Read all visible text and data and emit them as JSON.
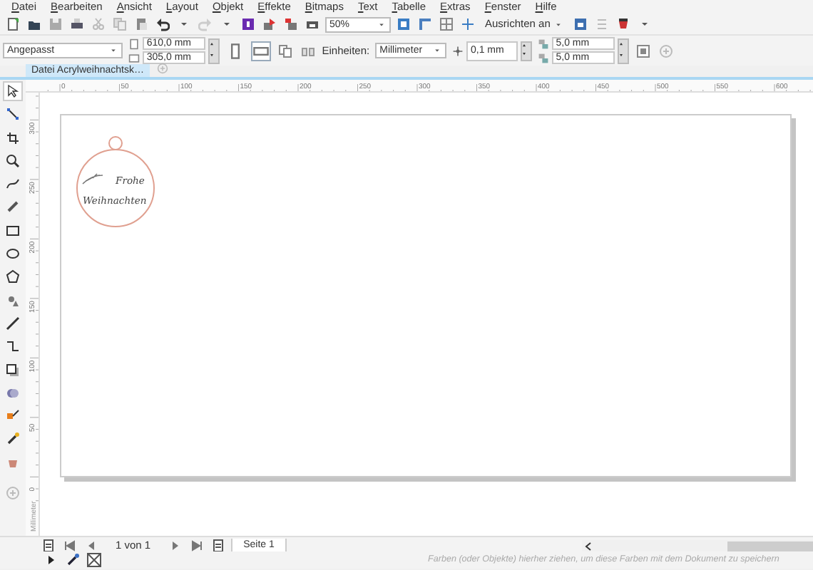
{
  "menu": [
    "Datei",
    "Bearbeiten",
    "Ansicht",
    "Layout",
    "Objekt",
    "Effekte",
    "Bitmaps",
    "Text",
    "Tabelle",
    "Extras",
    "Fenster",
    "Hilfe"
  ],
  "toolbar": {
    "zoom": "50%",
    "snap_menu": "Ausrichten an"
  },
  "property_bar": {
    "page_size": "Angepasst",
    "width": "610,0 mm",
    "height": "305,0 mm",
    "orientation": [
      {
        "kind": "portrait",
        "selected": false
      },
      {
        "kind": "landscape",
        "selected": true
      }
    ],
    "units_label": "Einheiten:",
    "units": "Millimeter",
    "nudge": "0,1 mm",
    "duplicate_x": "5,0 mm",
    "duplicate_y": "5,0 mm"
  },
  "document_tabs": [
    {
      "label": "Datei Acrylweihnachtsk…",
      "selected": true
    }
  ],
  "toolbox": [
    {
      "selected": true
    },
    {
      "selected": false
    },
    {
      "selected": false
    },
    {
      "selected": false
    },
    {
      "selected": false
    },
    {
      "selected": false
    },
    {
      "selected": false
    },
    {
      "selected": false
    },
    {
      "selected": false
    },
    {
      "selected": false
    },
    {
      "selected": false
    },
    {
      "selected": false
    },
    {
      "selected": false
    },
    {
      "selected": false
    },
    {
      "selected": false
    },
    {
      "selected": false
    },
    {
      "selected": false
    }
  ],
  "rulers": {
    "horizontal": [
      "0",
      "50",
      "100",
      "150",
      "200",
      "250",
      "300",
      "350",
      "400",
      "450",
      "500",
      "550",
      "600"
    ],
    "vertical": [
      "300",
      "250",
      "200",
      "150",
      "100",
      "50",
      "0"
    ],
    "unit": "Millimeter"
  },
  "artwork": {
    "text": [
      "Frohe",
      "Weihnachten"
    ]
  },
  "page_navigator": {
    "position": "1 von 1",
    "pages": [
      {
        "label": "Seite 1",
        "selected": true
      }
    ]
  },
  "palette_hint": "Farben (oder Objekte) hierher ziehen, um diese Farben mit dem Dokument zu speichern"
}
